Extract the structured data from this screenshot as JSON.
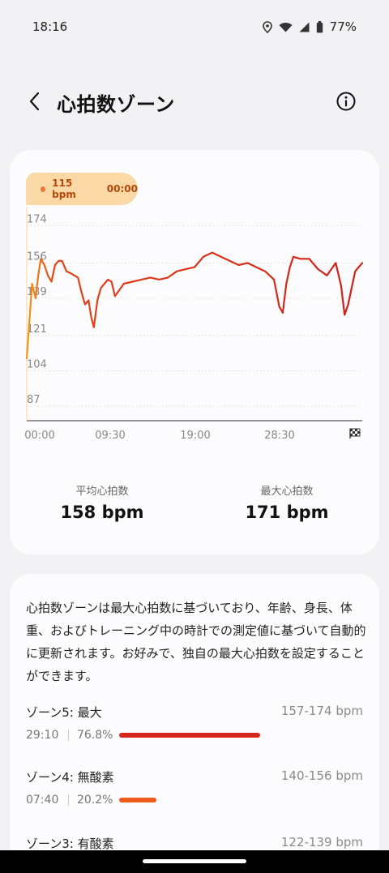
{
  "status_bar": {
    "time": "18:16",
    "battery": "77%"
  },
  "header": {
    "title": "心拍数ゾーン"
  },
  "tooltip": {
    "bpm": "115 bpm",
    "time": "00:00"
  },
  "chart_data": {
    "type": "line",
    "y_ticks": [
      "174",
      "156",
      "139",
      "121",
      "104",
      "87"
    ],
    "x_ticks": [
      "00:00",
      "09:30",
      "19:00",
      "28:30"
    ],
    "ylim": [
      80,
      180
    ],
    "x_unit": "minutes",
    "xlim": [
      0,
      38
    ],
    "grid": true,
    "series": [
      {
        "x": [
          0,
          0.3,
          0.6,
          1,
          1.3,
          1.6,
          2,
          2.4,
          2.8,
          3.2,
          3.6,
          4,
          4.5,
          5,
          5.4,
          5.8,
          6.2,
          6.6,
          7,
          7.3,
          7.6,
          8,
          8.4,
          8.8,
          9.2,
          9.6,
          10,
          11,
          12,
          13,
          14,
          15,
          16,
          17,
          18,
          19,
          20,
          21,
          22,
          23,
          24,
          25,
          26,
          27,
          28,
          28.6,
          29,
          29.4,
          29.8,
          30.2,
          31,
          32,
          33,
          34,
          35,
          35.6,
          36,
          36.4,
          36.8,
          37.2,
          37.6,
          38
        ],
        "y": [
          110,
          128,
          146,
          139,
          150,
          158,
          155,
          150,
          147,
          155,
          157,
          157,
          152,
          151,
          150,
          149,
          142,
          136,
          138,
          130,
          125,
          138,
          144,
          146,
          148,
          147,
          140,
          146,
          147,
          148,
          149,
          148,
          149,
          152,
          153,
          154,
          159,
          161,
          159,
          157,
          155,
          156,
          154,
          152,
          148,
          135,
          132,
          146,
          154,
          159,
          158,
          158,
          153,
          150,
          156,
          145,
          131,
          136,
          144,
          152,
          154,
          156
        ]
      }
    ]
  },
  "stats": {
    "avg_label": "平均心拍数",
    "avg_value": "158",
    "avg_unit": "bpm",
    "max_label": "最大心拍数",
    "max_value": "171",
    "max_unit": "bpm"
  },
  "description": "心拍数ゾーンは最大心拍数に基づいており、年齢、身長、体重、およびトレーニング中の時計での測定値に基づいて自動的に更新されます。お好みで、独自の最大心拍数を設定することができます。",
  "zones": [
    {
      "name": "ゾーン5: 最大",
      "range": "157-174 bpm",
      "time": "29:10",
      "pct": "76.8%",
      "fraction": 0.768,
      "color": "#d9261c"
    },
    {
      "name": "ゾーン4: 無酸素",
      "range": "140-156 bpm",
      "time": "07:40",
      "pct": "20.2%",
      "fraction": 0.202,
      "color": "#ef5a1d"
    },
    {
      "name": "ゾーン3: 有酸素",
      "range": "122-139 bpm"
    }
  ]
}
